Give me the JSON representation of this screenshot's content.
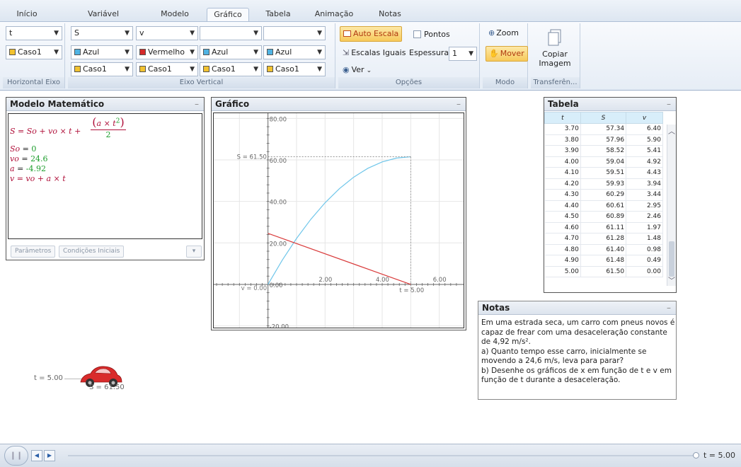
{
  "tabs": [
    "Início",
    "Variável Independente",
    "Modelo",
    "Gráfico",
    "Tabela",
    "Animação",
    "Notas"
  ],
  "active_tab": "Gráfico",
  "ribbon": {
    "horizontal_axis": {
      "variable": "t",
      "case": "Caso1",
      "label": "Horizontal Eixo"
    },
    "vertical_axis": {
      "label": "Eixo Vertical",
      "variables": [
        "S",
        "v",
        "",
        ""
      ],
      "colors": [
        {
          "name": "Azul",
          "hex": "#4fb3e3"
        },
        {
          "name": "Vermelho",
          "hex": "#d42a2a"
        },
        {
          "name": "Azul",
          "hex": "#4fb3e3"
        },
        {
          "name": "Azul",
          "hex": "#4fb3e3"
        }
      ],
      "cases": [
        "Caso1",
        "Caso1",
        "Caso1",
        "Caso1"
      ],
      "case_color": "#f2c230"
    },
    "options": {
      "label": "Opções",
      "auto_scale": "Auto Escala",
      "points": "Pontos",
      "equal_scales": "Escalas Iguais",
      "thickness_label": "Espessura:",
      "thickness": "1",
      "view": "Ver"
    },
    "mode": {
      "label": "Modo",
      "zoom": "Zoom",
      "move": "Mover"
    },
    "transfer": {
      "label": "Transferên...",
      "copy_line1": "Copiar",
      "copy_line2": "Imagem"
    }
  },
  "model_panel": {
    "title": "Modelo Matemático",
    "eq_main_lhs": "S = So + vo × t +",
    "eq_frac_num": "a × t",
    "eq_frac_exp": "2",
    "eq_frac_den": "2",
    "so_name": "So",
    "so_eq": "=",
    "so_val": "0",
    "vo_name": "vo",
    "vo_eq": "=",
    "vo_val": "24.6",
    "a_name": "a",
    "a_eq": "=",
    "a_val": "-4.92",
    "v_eq": "v = vo + a × t",
    "params_button": "Parâmetros",
    "initial_button": "Condições Iniciais",
    "menu_glyph": "▾"
  },
  "graph_panel": {
    "title": "Gráfico",
    "y_ticks": [
      "80.00",
      "60.00",
      "40.00",
      "20.00",
      "0.00",
      "-20.00"
    ],
    "x_ticks": [
      "2.00",
      "4.00",
      "6.00"
    ],
    "readout_s": "S = 61.50",
    "readout_v": "v = 0.00",
    "readout_t": "t = 5.00"
  },
  "chart_data": {
    "type": "line",
    "xlim": [
      -1.9,
      6.9
    ],
    "ylim": [
      -21.5,
      82.5
    ],
    "series": [
      {
        "name": "S",
        "color": "#6fc6ea",
        "x": [
          0,
          0.5,
          1,
          1.5,
          2,
          2.5,
          3,
          3.5,
          4,
          4.5,
          5
        ],
        "y": [
          0,
          11.69,
          22.14,
          31.37,
          39.36,
          46.13,
          51.66,
          55.97,
          59.04,
          60.89,
          61.5
        ]
      },
      {
        "name": "v",
        "color": "#d93b3b",
        "x": [
          0,
          5
        ],
        "y": [
          24.6,
          0
        ]
      }
    ],
    "marker_t": 5.0,
    "marker_s": 61.5,
    "grid": true
  },
  "table_panel": {
    "title": "Tabela",
    "columns": [
      "t",
      "S",
      "v"
    ],
    "rows": [
      [
        "3.70",
        "57.34",
        "6.40"
      ],
      [
        "3.80",
        "57.96",
        "5.90"
      ],
      [
        "3.90",
        "58.52",
        "5.41"
      ],
      [
        "4.00",
        "59.04",
        "4.92"
      ],
      [
        "4.10",
        "59.51",
        "4.43"
      ],
      [
        "4.20",
        "59.93",
        "3.94"
      ],
      [
        "4.30",
        "60.29",
        "3.44"
      ],
      [
        "4.40",
        "60.61",
        "2.95"
      ],
      [
        "4.50",
        "60.89",
        "2.46"
      ],
      [
        "4.60",
        "61.11",
        "1.97"
      ],
      [
        "4.70",
        "61.28",
        "1.48"
      ],
      [
        "4.80",
        "61.40",
        "0.98"
      ],
      [
        "4.90",
        "61.48",
        "0.49"
      ],
      [
        "5.00",
        "61.50",
        "0.00"
      ]
    ]
  },
  "notes_panel": {
    "title": "Notas",
    "lines": [
      "Em uma estrada seca, um carro com pneus novos é",
      "capaz de frear com uma desaceleração constante",
      "de 4,92 m/s².",
      "a) Quanto tempo esse carro, inicialmente se",
      "movendo a 24,6 m/s, leva para parar?",
      "b) Desenhe os gráficos de x em função de t e v em",
      "função de t durante a desaceleração."
    ]
  },
  "animation": {
    "t_label": "t = 5.00",
    "s_label": "S = 61.50",
    "car_color": "#d92b2b"
  },
  "bottom_bar": {
    "t_readout": "t = 5.00"
  }
}
